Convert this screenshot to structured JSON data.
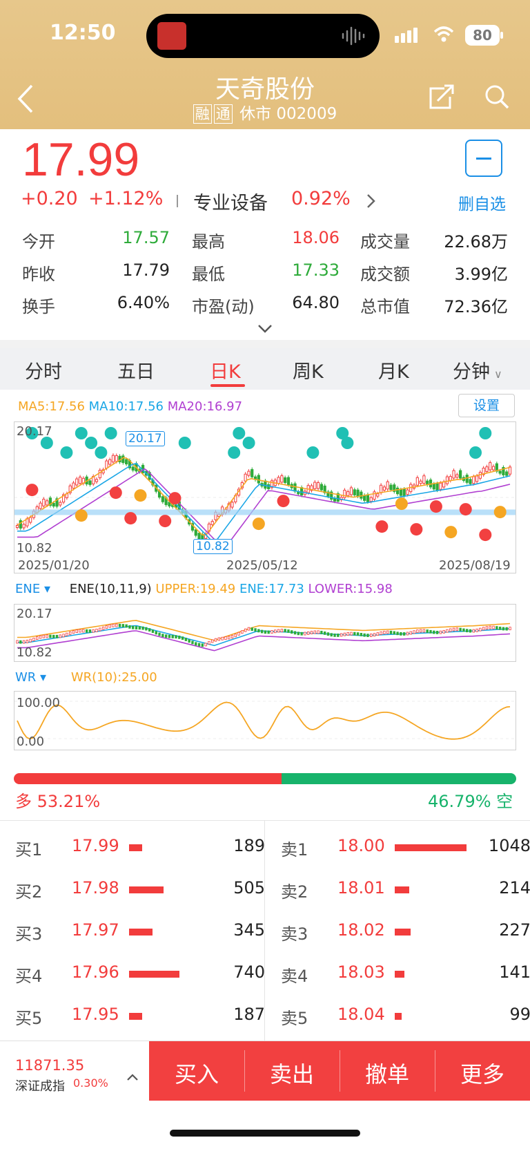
{
  "status_bar": {
    "time": "12:50",
    "battery": "80"
  },
  "header": {
    "title": "天奇股份",
    "tag1": "融",
    "tag2": "通",
    "status": "休市",
    "code": "002009"
  },
  "quote": {
    "price": "17.99",
    "change": "+0.20",
    "change_pct": "+1.12%",
    "sector": "专业设备",
    "sector_pct": "0.92%",
    "watch_label": "删自选",
    "stats": [
      {
        "label": "今开",
        "value": "17.57",
        "color": "green"
      },
      {
        "label": "最高",
        "value": "18.06",
        "color": "red"
      },
      {
        "label": "成交量",
        "value": "22.68万",
        "color": "black"
      },
      {
        "label": "昨收",
        "value": "17.79",
        "color": "black"
      },
      {
        "label": "最低",
        "value": "17.33",
        "color": "green"
      },
      {
        "label": "成交额",
        "value": "3.99亿",
        "color": "black"
      },
      {
        "label": "换手",
        "value": "6.40%",
        "color": "black"
      },
      {
        "label": "市盈(动)",
        "value": "64.80",
        "color": "black"
      },
      {
        "label": "总市值",
        "value": "72.36亿",
        "color": "black"
      }
    ]
  },
  "tabs": [
    "分时",
    "五日",
    "日K",
    "周K",
    "月K",
    "分钟"
  ],
  "active_tab": "日K",
  "kline": {
    "ma5": "MA5:17.56",
    "ma10": "MA10:17.56",
    "ma20": "MA20:16.97",
    "settings_label": "设置",
    "high_label": "20.17",
    "low_label": "10.82",
    "high_marker": "20.17",
    "low_marker": "10.82",
    "dates": [
      "2025/01/20",
      "2025/05/12",
      "2025/08/19"
    ]
  },
  "ene": {
    "name": "ENE",
    "params": "ENE(10,11,9)",
    "upper": "UPPER:19.49",
    "ene": "ENE:17.73",
    "lower": "LOWER:15.98",
    "high_label": "20.17",
    "low_label": "10.82"
  },
  "wr": {
    "name": "WR",
    "value": "WR(10):25.00",
    "top_label": "100.00",
    "bottom_label": "0.00"
  },
  "long_short": {
    "long_label": "多",
    "long_pct": "53.21%",
    "long_fraction": 0.5321,
    "short_pct": "46.79%",
    "short_label": "空"
  },
  "order_book": {
    "bids": [
      {
        "label": "买1",
        "price": "17.99",
        "volume": "189"
      },
      {
        "label": "买2",
        "price": "17.98",
        "volume": "505"
      },
      {
        "label": "买3",
        "price": "17.97",
        "volume": "345"
      },
      {
        "label": "买4",
        "price": "17.96",
        "volume": "740"
      },
      {
        "label": "买5",
        "price": "17.95",
        "volume": "187"
      }
    ],
    "asks": [
      {
        "label": "卖1",
        "price": "18.00",
        "volume": "1048"
      },
      {
        "label": "卖2",
        "price": "18.01",
        "volume": "214"
      },
      {
        "label": "卖3",
        "price": "18.02",
        "volume": "227"
      },
      {
        "label": "卖4",
        "price": "18.03",
        "volume": "141"
      },
      {
        "label": "卖5",
        "price": "18.04",
        "volume": "99"
      }
    ]
  },
  "bottom": {
    "index_value": "11871.35",
    "index_name": "深证成指",
    "index_pct": "0.30%",
    "actions": [
      "买入",
      "卖出",
      "撤单",
      "更多"
    ]
  },
  "colors": {
    "up": "#f23c3c",
    "down": "#2eab3a",
    "accent": "#1a8fe6",
    "header": "#e5c485"
  }
}
